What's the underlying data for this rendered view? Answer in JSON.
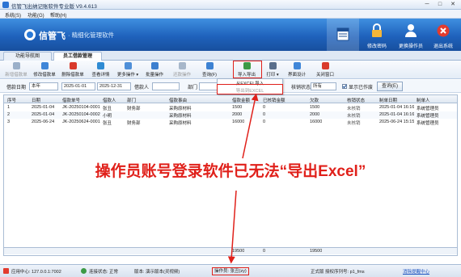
{
  "window": {
    "title": "信管飞出纳记账软件专业版 V9.4.613",
    "min": "─",
    "max": "□",
    "close": "✕"
  },
  "menu": [
    "系统(S)",
    "功能(G)",
    "帮助(H)"
  ],
  "banner": {
    "brand": "信管飞",
    "slogan": "· 精细化管理软件",
    "buttons": [
      {
        "label": "修改密码"
      },
      {
        "label": "更换操作员"
      },
      {
        "label": "退出系统"
      }
    ],
    "accent": "#1f62bc"
  },
  "tabs": [
    {
      "label": "功能导航图"
    },
    {
      "label": "员工借款管理"
    }
  ],
  "toolbar": {
    "items": [
      {
        "label": "新增借款单",
        "enabled": false,
        "icon": "add-document-icon",
        "color": "#9bb0c9"
      },
      {
        "label": "修改借款单",
        "enabled": true,
        "icon": "edit-icon",
        "color": "#3f86d8"
      },
      {
        "label": "删除借款单",
        "enabled": true,
        "icon": "delete-icon",
        "color": "#d93a2b"
      },
      {
        "label": "查看详情",
        "enabled": true,
        "icon": "view-details-icon",
        "color": "#2f8bd3"
      },
      {
        "label": "更多操作 ▾",
        "enabled": true,
        "icon": "more-icon",
        "color": "#4f8fd8"
      },
      {
        "label": "批量操作",
        "enabled": true,
        "icon": "batch-icon",
        "color": "#3c7fcf"
      },
      {
        "label": "还款操作",
        "enabled": false,
        "icon": "repay-icon",
        "color": "#a7b7ca"
      },
      {
        "label": "查询(F)",
        "enabled": true,
        "icon": "search-icon",
        "color": "#3d82d2"
      },
      {
        "label": "导入导出",
        "enabled": true,
        "icon": "import-export-icon",
        "color": "#3c9a45"
      },
      {
        "label": "打印 ▾",
        "enabled": true,
        "icon": "print-icon",
        "color": "#5a6f8c"
      },
      {
        "label": "界面设计",
        "enabled": true,
        "icon": "design-icon",
        "color": "#3f86d8"
      },
      {
        "label": "关闭窗口",
        "enabled": true,
        "icon": "close-window-icon",
        "color": "#d93a2b"
      }
    ]
  },
  "dropdown": {
    "items": [
      "从EXCEL导入",
      "导出到EXCEL"
    ]
  },
  "filter": {
    "date_label": "借款日期",
    "period": "本年",
    "start_date": "2025-01-01",
    "end_date": "2025-12-31",
    "borrower_label": "借款人",
    "borrower": "",
    "dept_label": "部门",
    "dept": "",
    "verify_label": "核销状态",
    "verify": "所有",
    "show_verified": "显示已作废",
    "query": "查询(E)"
  },
  "table": {
    "columns": [
      "序号",
      "日期",
      "借款单号",
      "借款人",
      "部门",
      "借款事由",
      "借款金额",
      "已核销金额",
      "欠款",
      "核销状态",
      "制单日期",
      "制单人"
    ],
    "rows": [
      [
        "1",
        "2025-01-04",
        "JK-20250104-0001",
        "张丑",
        "财务部",
        "采购原材料",
        "1500",
        "0",
        "1500",
        "未核销",
        "2025-01-04 16:16",
        "系统管理员"
      ],
      [
        "2",
        "2025-01-04",
        "JK-20250104-0002",
        "小明",
        "",
        "采购原材料",
        "2000",
        "0",
        "2000",
        "未核销",
        "2025-01-04 16:16",
        "系统管理员"
      ],
      [
        "3",
        "2025-06-24",
        "JK-20250624-0001",
        "张丑",
        "财务部",
        "采购原材料",
        "16000",
        "0",
        "16000",
        "未核销",
        "2025-06-24 15:15",
        "系统管理员"
      ]
    ],
    "totals": {
      "amount": "19500",
      "verified": "0",
      "owed": "19500"
    }
  },
  "status": {
    "app_center": "应用中心: 127.0.0.1:7002",
    "connection": "连接状态: 正常",
    "edition": "版本: 演示版本(灵视频)",
    "operator": "操作员: 张丑(zy)",
    "license": "正式版 授权序列号: p1_fms",
    "update": "消除提醒中心"
  },
  "annotation": "操作员账号登录软件已无法“导出Excel”"
}
